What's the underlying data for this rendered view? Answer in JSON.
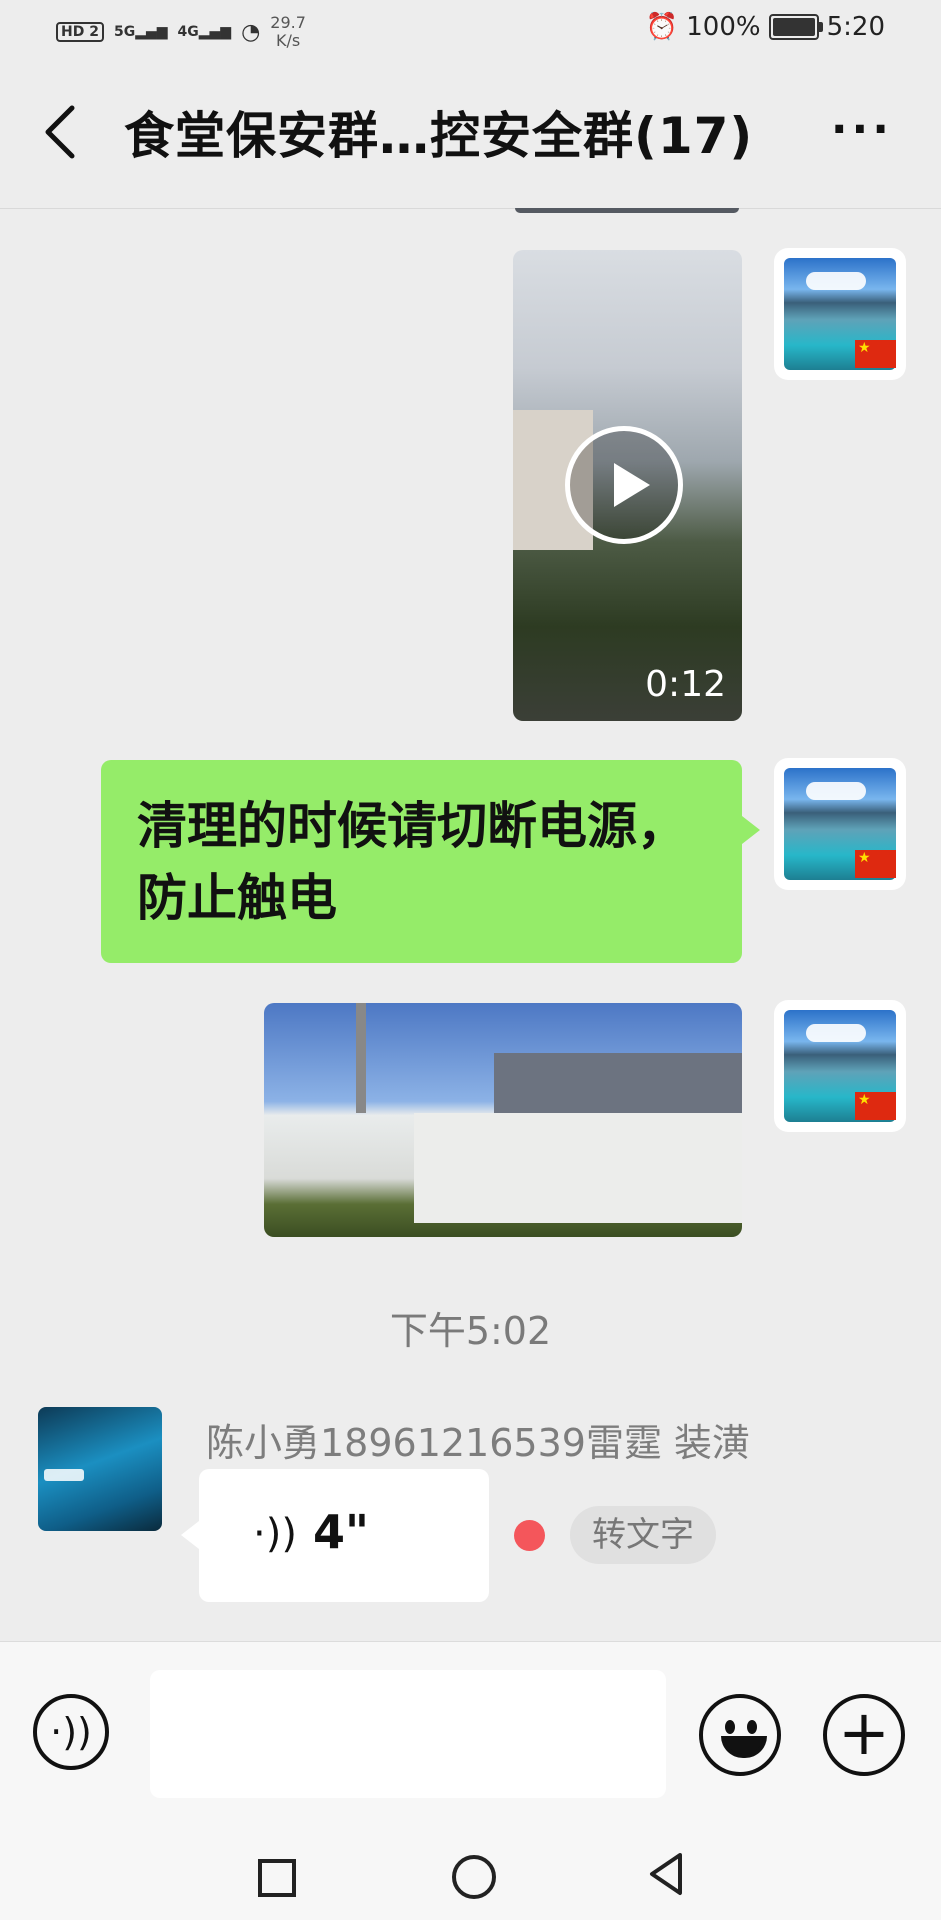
{
  "status_bar": {
    "hd_label": "HD",
    "sim_label": "2",
    "net_5g": "5G",
    "net_4g": "4G",
    "net_speed_value": "29.7",
    "net_speed_unit": "K/s",
    "battery": "100%",
    "time": "5:20"
  },
  "header": {
    "title": "食堂保安群…控安全群(17)",
    "more_label": "···"
  },
  "messages": {
    "video_duration": "0:12",
    "text_message": "清理的时候请切断电源，防止触电",
    "timestamp": "下午5:02",
    "sender_name": "陈小勇18961216539雷霆  装潢",
    "voice_duration": "4\"",
    "voice_icon_glyph": "·))",
    "convert_to_text": "转文字"
  },
  "input_bar": {
    "plus_glyph": "+"
  },
  "icons": [
    "back-icon",
    "more-icon",
    "play-icon",
    "voice-icon",
    "emoji-icon",
    "plus-icon",
    "nav-recents-icon",
    "nav-home-icon",
    "nav-back-icon"
  ],
  "colors": {
    "background": "#ededed",
    "bubble_green": "#95ec69",
    "unread_dot": "#f4565b"
  }
}
